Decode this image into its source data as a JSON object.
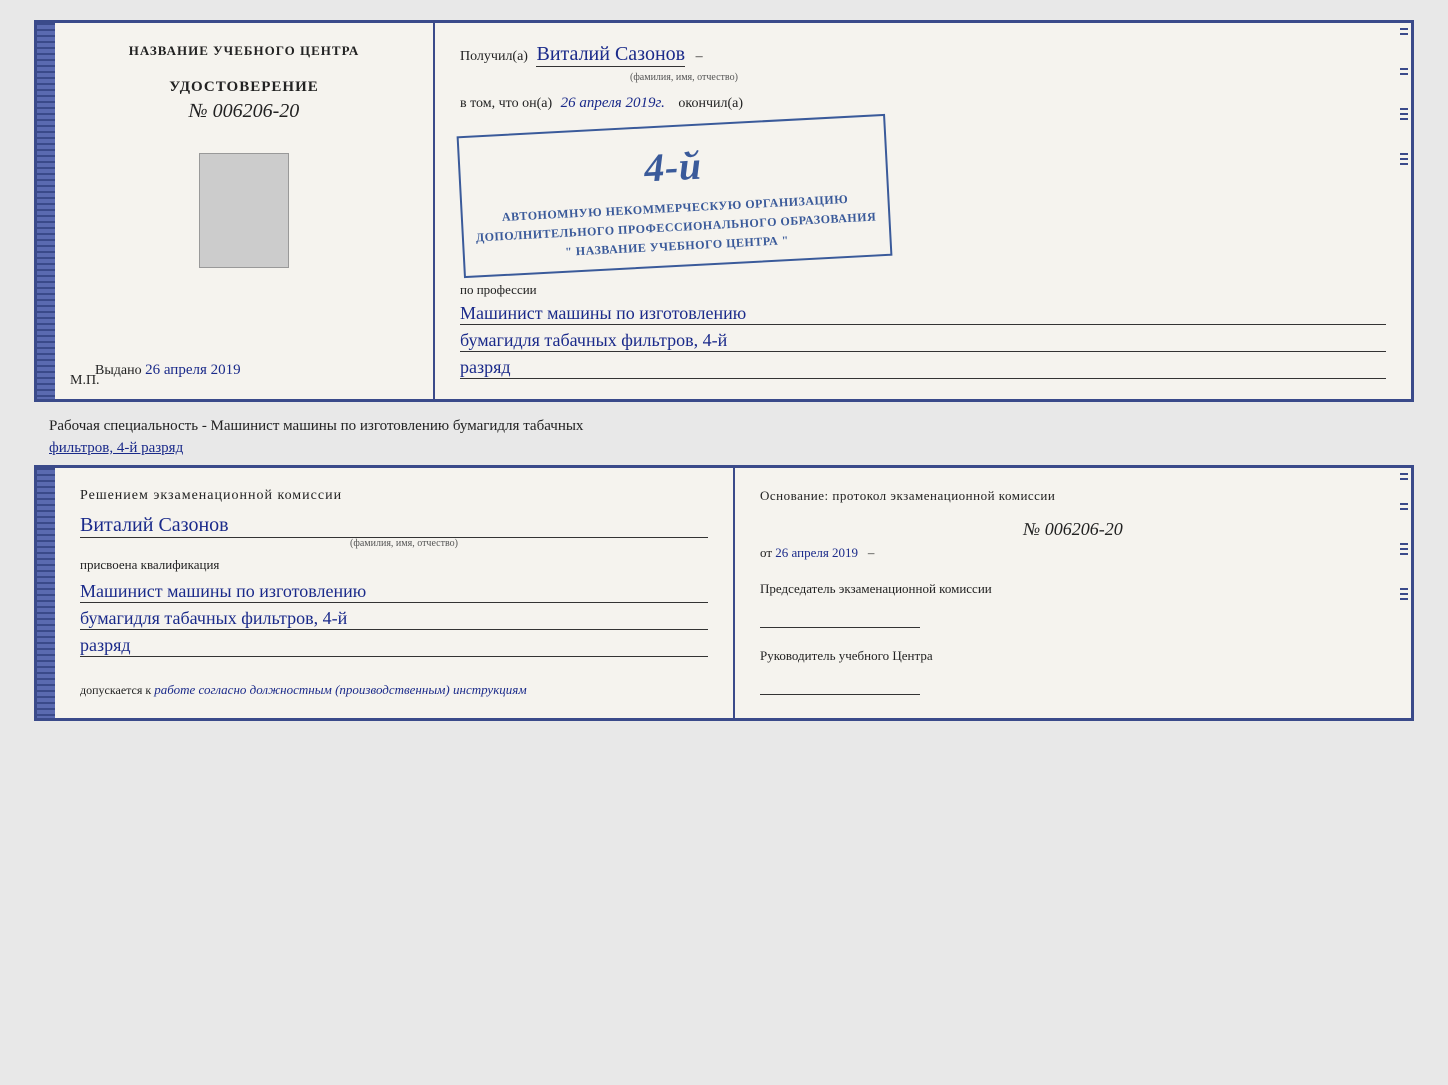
{
  "top_certificate": {
    "left": {
      "title": "НАЗВАНИЕ УЧЕБНОГО ЦЕНТРА",
      "udostoverenie_label": "УДОСТОВЕРЕНИЕ",
      "number_prefix": "№",
      "number": "006206-20",
      "vydano_label": "Выдано",
      "vydano_date": "26 апреля 2019",
      "mp_label": "М.П."
    },
    "right": {
      "poluchil_label": "Получил(а)",
      "recipient_name": "Виталий Сазонов",
      "fio_label": "(фамилия, имя, отчество)",
      "vtom_label": "в том, что он(а)",
      "date_handwritten": "26 апреля 2019г.",
      "okonchil_label": "окончил(а)",
      "stamp_line1": "АВТОНОМНУЮ НЕКОММЕРЧЕСКУЮ ОРГАНИЗАЦИЮ",
      "stamp_line2": "ДОПОЛНИТЕЛЬНОГО ПРОФЕССИОНАЛЬНОГО ОБРАЗОВАНИЯ",
      "stamp_line3": "\" НАЗВАНИЕ УЧЕБНОГО ЦЕНТРА \"",
      "stamp_number": "4-й",
      "po_professii_label": "по профессии",
      "profession_line1": "Машинист машины по изготовлению",
      "profession_line2": "бумагидля табачных фильтров, 4-й",
      "profession_line3": "разряд"
    }
  },
  "middle": {
    "text": "Рабочая специальность - Машинист машины по изготовлению бумагидля табачных",
    "text2_underlined": "фильтров, 4-й разряд"
  },
  "bottom_certificate": {
    "left": {
      "komissia_title": "Решением  экзаменационной  комиссии",
      "name": "Виталий Сазонов",
      "fio_label": "(фамилия, имя, отчество)",
      "prisvoena_label": "присвоена квалификация",
      "qualification_line1": "Машинист машины по изготовлению",
      "qualification_line2": "бумагидля табачных фильтров, 4-й",
      "qualification_line3": "разряд",
      "dopuskaetsya_label": "допускается к",
      "dopuskaetsya_text": "работе согласно должностным (производственным) инструкциям"
    },
    "right": {
      "osnovanie_label": "Основание: протокол экзаменационной  комиссии",
      "protocol_number": "№  006206-20",
      "ot_label": "от",
      "protocol_date": "26 апреля 2019",
      "predsedatel_label": "Председатель экзаменационной комиссии",
      "rukovoditel_label": "Руководитель учебного Центра"
    }
  }
}
